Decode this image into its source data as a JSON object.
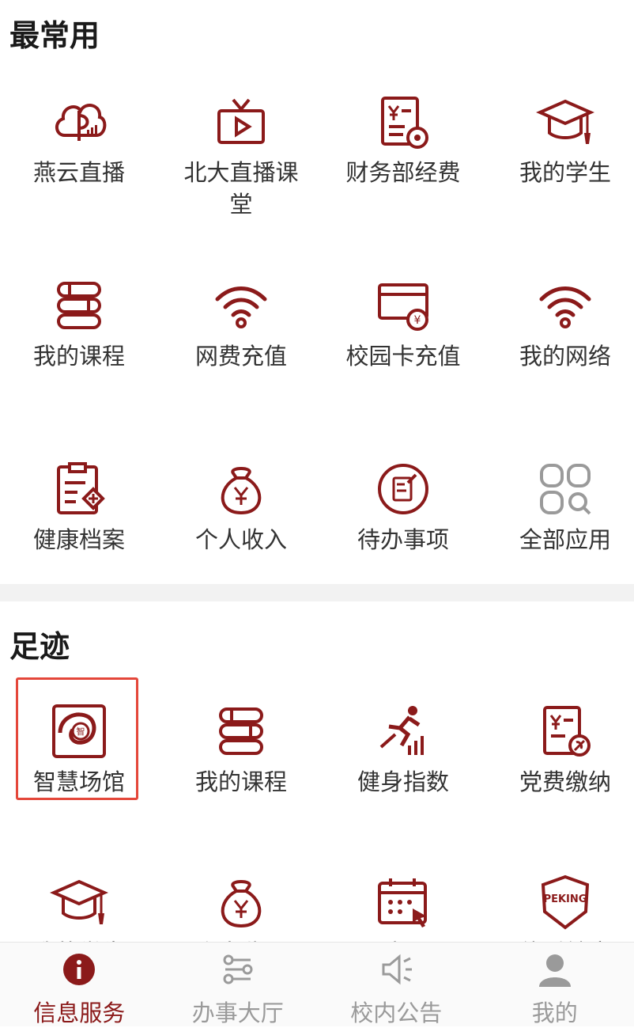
{
  "colors": {
    "accent": "#8b1a1a",
    "inactive": "#9a9a9a",
    "highlight": "#e4473a"
  },
  "sections": {
    "frequent": {
      "title": "最常用",
      "apps": [
        {
          "label": "燕云直播",
          "icon": "cloud-live-icon"
        },
        {
          "label": "北大直播课堂",
          "icon": "tv-icon"
        },
        {
          "label": "财务部经费",
          "icon": "finance-doc-icon"
        },
        {
          "label": "我的学生",
          "icon": "graduation-cap-icon"
        },
        {
          "label": "我的课程",
          "icon": "books-icon"
        },
        {
          "label": "网费充值",
          "icon": "wifi-icon"
        },
        {
          "label": "校园卡充值",
          "icon": "campus-card-icon"
        },
        {
          "label": "我的网络",
          "icon": "wifi-icon"
        },
        {
          "label": "健康档案",
          "icon": "health-record-icon"
        },
        {
          "label": "个人收入",
          "icon": "money-bag-icon"
        },
        {
          "label": "待办事项",
          "icon": "todo-icon"
        },
        {
          "label": "全部应用",
          "icon": "all-apps-icon"
        }
      ]
    },
    "footprint": {
      "title": "足迹",
      "apps": [
        {
          "label": "智慧场馆",
          "icon": "smart-venue-icon"
        },
        {
          "label": "我的课程",
          "icon": "books-icon"
        },
        {
          "label": "健身指数",
          "icon": "fitness-icon"
        },
        {
          "label": "党费缴纳",
          "icon": "party-fee-icon"
        },
        {
          "label": "我的学生",
          "icon": "graduation-cap-icon"
        },
        {
          "label": "个人收入",
          "icon": "money-bag-icon"
        },
        {
          "label": "选课",
          "icon": "calendar-select-icon"
        },
        {
          "label": "体质健康",
          "icon": "peking-shield-icon"
        }
      ]
    }
  },
  "tabbar": {
    "items": [
      {
        "label": "信息服务",
        "icon": "info-icon",
        "active": true
      },
      {
        "label": "办事大厅",
        "icon": "flow-icon",
        "active": false
      },
      {
        "label": "校内公告",
        "icon": "speaker-icon",
        "active": false
      },
      {
        "label": "我的",
        "icon": "person-icon",
        "active": false
      }
    ]
  }
}
